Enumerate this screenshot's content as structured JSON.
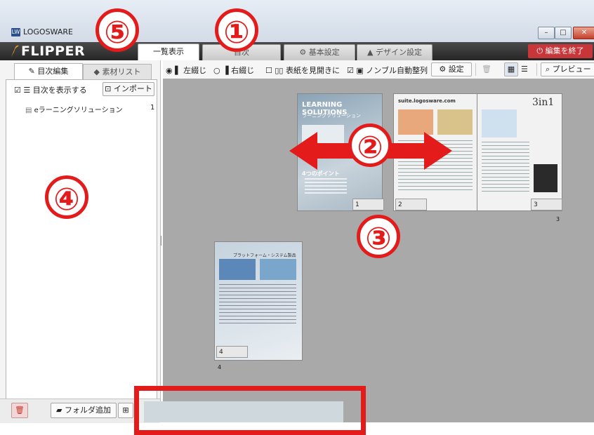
{
  "window": {
    "app_title": "LOGOSWARE",
    "app_icon": "LW",
    "controls": [
      "minimize",
      "maximize",
      "close"
    ]
  },
  "brand": {
    "logo_text": "FLIPPER"
  },
  "main_tabs": [
    {
      "label": "一覧表示",
      "active": true
    },
    {
      "label": "目次",
      "active": false
    },
    {
      "label": "基本設定",
      "active": false,
      "icon": "gear-icon"
    },
    {
      "label": "デザイン設定",
      "active": false,
      "icon": "design-icon"
    }
  ],
  "end_edit_button": "編集を終了",
  "left_panel": {
    "tabs": [
      {
        "label": "目次編集",
        "active": true
      },
      {
        "label": "素材リスト",
        "active": false
      }
    ],
    "show_toc_label": "目次を表示する",
    "show_toc_checked": true,
    "import_label": "インポート",
    "toc_items": [
      {
        "label": "eラーニングソリューション",
        "page": "1"
      }
    ],
    "footer": {
      "add_folder_label": "フォルダ追加"
    }
  },
  "toolbar": {
    "binding_left": "左綴じ",
    "binding_right": "右綴じ",
    "cover_spread": "表紙を見開きに",
    "auto_align": "ノンブル自動整列",
    "settings": "設定",
    "preview": "プレビュー"
  },
  "pages": [
    {
      "label": "1",
      "title": "LEARNING SOLUTIONS",
      "subtitle": "ラーニングソリューション",
      "points": "4つのポイント"
    },
    {
      "label": "2",
      "title": "suite.logosware.com"
    },
    {
      "label": "3",
      "title": "3in1"
    },
    {
      "label": "4",
      "title": "プラットフォーム・システム製品"
    }
  ],
  "page_numbers_under": {
    "p3": "3",
    "p4": "4"
  },
  "annotations": {
    "badges": [
      "①",
      "②",
      "③",
      "④",
      "⑤"
    ],
    "color": "#e31b1b"
  },
  "colors": {
    "accent_red": "#c8363a",
    "canvas_gray": "#a9a9a9",
    "annotation_red": "#e31b1b"
  }
}
